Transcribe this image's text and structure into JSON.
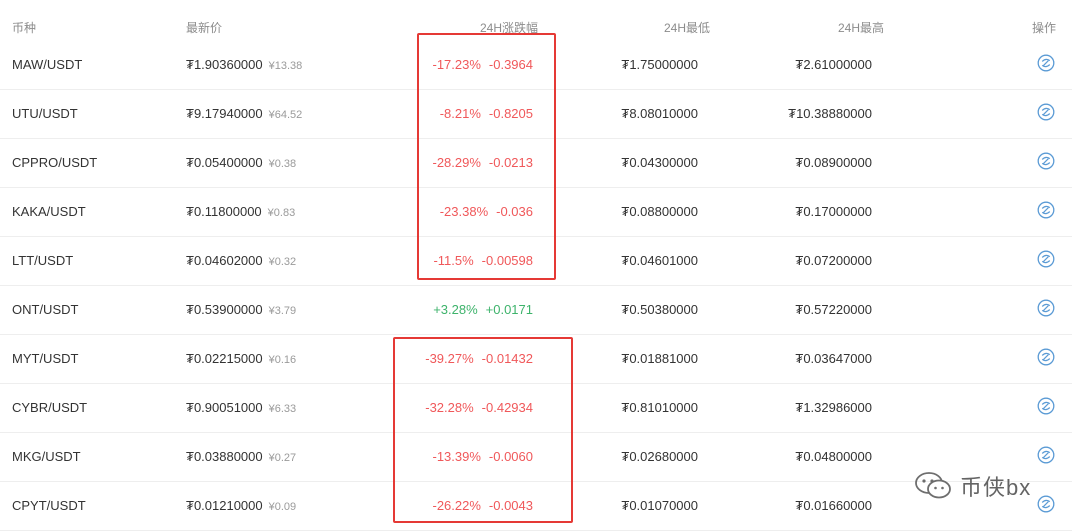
{
  "columns": {
    "pair": "币种",
    "price": "最新价",
    "change": "24H涨跌幅",
    "low": "24H最低",
    "high": "24H最高",
    "action": "操作"
  },
  "colors": {
    "down": "#f0585a",
    "up": "#3db36b",
    "highlight_box": "#e53935",
    "action_icon": "#5b9bd5"
  },
  "rows": [
    {
      "pair": "MAW/USDT",
      "price": "₮1.90360000",
      "cny": "¥13.38",
      "pct": "-17.23%",
      "delta": "-0.3964",
      "direction": "down",
      "low": "₮1.75000000",
      "high": "₮2.61000000"
    },
    {
      "pair": "UTU/USDT",
      "price": "₮9.17940000",
      "cny": "¥64.52",
      "pct": "-8.21%",
      "delta": "-0.8205",
      "direction": "down",
      "low": "₮8.08010000",
      "high": "₮10.38880000"
    },
    {
      "pair": "CPPRO/USDT",
      "price": "₮0.05400000",
      "cny": "¥0.38",
      "pct": "-28.29%",
      "delta": "-0.0213",
      "direction": "down",
      "low": "₮0.04300000",
      "high": "₮0.08900000"
    },
    {
      "pair": "KAKA/USDT",
      "price": "₮0.11800000",
      "cny": "¥0.83",
      "pct": "-23.38%",
      "delta": "-0.036",
      "direction": "down",
      "low": "₮0.08800000",
      "high": "₮0.17000000"
    },
    {
      "pair": "LTT/USDT",
      "price": "₮0.04602000",
      "cny": "¥0.32",
      "pct": "-11.5%",
      "delta": "-0.00598",
      "direction": "down",
      "low": "₮0.04601000",
      "high": "₮0.07200000"
    },
    {
      "pair": "ONT/USDT",
      "price": "₮0.53900000",
      "cny": "¥3.79",
      "pct": "+3.28%",
      "delta": "+0.0171",
      "direction": "up",
      "low": "₮0.50380000",
      "high": "₮0.57220000"
    },
    {
      "pair": "MYT/USDT",
      "price": "₮0.02215000",
      "cny": "¥0.16",
      "pct": "-39.27%",
      "delta": "-0.01432",
      "direction": "down",
      "low": "₮0.01881000",
      "high": "₮0.03647000"
    },
    {
      "pair": "CYBR/USDT",
      "price": "₮0.90051000",
      "cny": "¥6.33",
      "pct": "-32.28%",
      "delta": "-0.42934",
      "direction": "down",
      "low": "₮0.81010000",
      "high": "₮1.32986000"
    },
    {
      "pair": "MKG/USDT",
      "price": "₮0.03880000",
      "cny": "¥0.27",
      "pct": "-13.39%",
      "delta": "-0.0060",
      "direction": "down",
      "low": "₮0.02680000",
      "high": "₮0.04800000"
    },
    {
      "pair": "CPYT/USDT",
      "price": "₮0.01210000",
      "cny": "¥0.09",
      "pct": "-26.22%",
      "delta": "-0.0043",
      "direction": "down",
      "low": "₮0.01070000",
      "high": "₮0.01660000"
    }
  ],
  "watermark": {
    "text": "币侠bx",
    "icon": "wechat-icon"
  }
}
